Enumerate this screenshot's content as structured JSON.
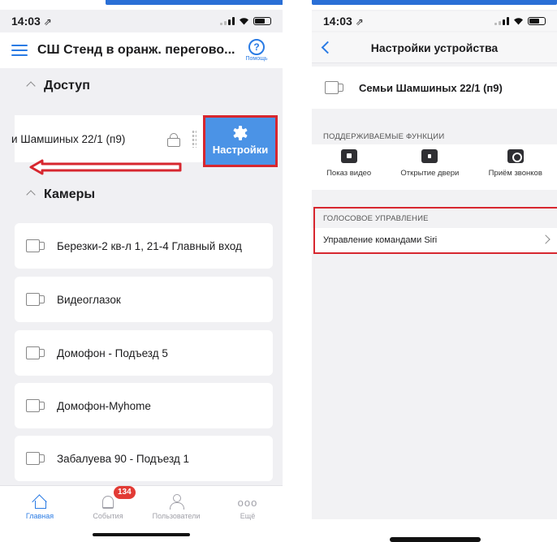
{
  "left": {
    "status": {
      "time": "14:03",
      "time_arrow": "⇗"
    },
    "header": {
      "title": "СШ Стенд в оранж. перегово...",
      "help_label": "Помощь",
      "help_glyph": "?"
    },
    "sections": {
      "access": "Доступ",
      "cameras": "Камеры"
    },
    "access_item": {
      "label": "и Шамшиных 22/1  (п9)",
      "settings_label": "Настройки"
    },
    "cameras": [
      {
        "label": "Березки-2 кв-л 1, 21-4 Главный вход"
      },
      {
        "label": "Видеоглазок"
      },
      {
        "label": "Домофон - Подъезд 5"
      },
      {
        "label": "Домофон-Myhome"
      },
      {
        "label": "Забалуева 90 - Подъезд 1"
      }
    ],
    "tabs": [
      {
        "label": "Главная"
      },
      {
        "label": "События",
        "badge": "134"
      },
      {
        "label": "Пользователи"
      },
      {
        "label": "Ещё",
        "glyph": "ooo"
      }
    ]
  },
  "right": {
    "status": {
      "time": "14:03",
      "time_arrow": "⇗"
    },
    "header": {
      "title": "Настройки устройства"
    },
    "device": {
      "name": "Семьи Шамшиных 22/1  (п9)"
    },
    "supported": {
      "caption": "ПОДДЕРЖИВАЕМЫЕ ФУНКЦИИ",
      "items": [
        {
          "label": "Показ видео",
          "icon": "video-icon"
        },
        {
          "label": "Открытие двери",
          "icon": "lock-icon"
        },
        {
          "label": "Приём звонков",
          "icon": "phone-icon"
        }
      ]
    },
    "voice": {
      "caption": "ГОЛОСОВОЕ УПРАВЛЕНИЕ",
      "item": "Управление командами Siri"
    }
  },
  "colors": {
    "accent": "#2a7be4",
    "highlight": "#d7272f",
    "settings_button": "#4b93e6",
    "badge": "#e23b35"
  }
}
